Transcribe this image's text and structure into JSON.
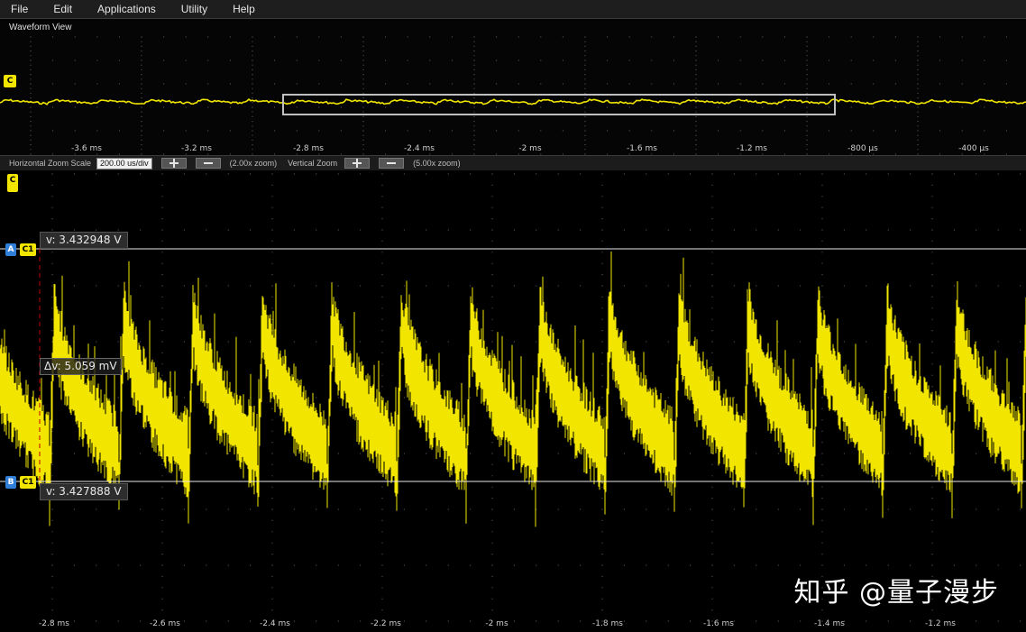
{
  "menu": [
    "File",
    "Edit",
    "Applications",
    "Utility",
    "Help"
  ],
  "waveform_view": {
    "title": "Waveform View",
    "channel_badge": "C",
    "top_ticks": [
      "-3.6 ms",
      "-3.2 ms",
      "-2.8 ms",
      "-2.4 ms",
      "-2 ms",
      "-1.6 ms",
      "-1.2 ms",
      "-800 µs",
      "-400 µs"
    ]
  },
  "zoom": {
    "h_label": "Horizontal Zoom Scale",
    "h_value": "200.00 us/div",
    "h_factor": "(2.00x zoom)",
    "v_label": "Vertical Zoom",
    "v_factor": "(5.00x zoom)"
  },
  "main": {
    "channel_badge": "C",
    "cursor_a": {
      "label": "A",
      "channel": "C1",
      "value": "v: 3.432948 V"
    },
    "cursor_b": {
      "label": "B",
      "channel": "C1",
      "value": "v: 3.427888 V"
    },
    "delta": "Δv: 5.059 mV",
    "bottom_ticks": [
      "-2.8 ms",
      "-2.6 ms",
      "-2.4 ms",
      "-2.2 ms",
      "-2 ms",
      "-1.8 ms",
      "-1.6 ms",
      "-1.4 ms",
      "-1.2 ms"
    ]
  },
  "watermark": "知乎 @量子漫步",
  "colors": {
    "trace": "#f2e600",
    "cursor": "#e8e8e8",
    "marker": "#c00000",
    "badge_blue": "#2f7fd8"
  }
}
